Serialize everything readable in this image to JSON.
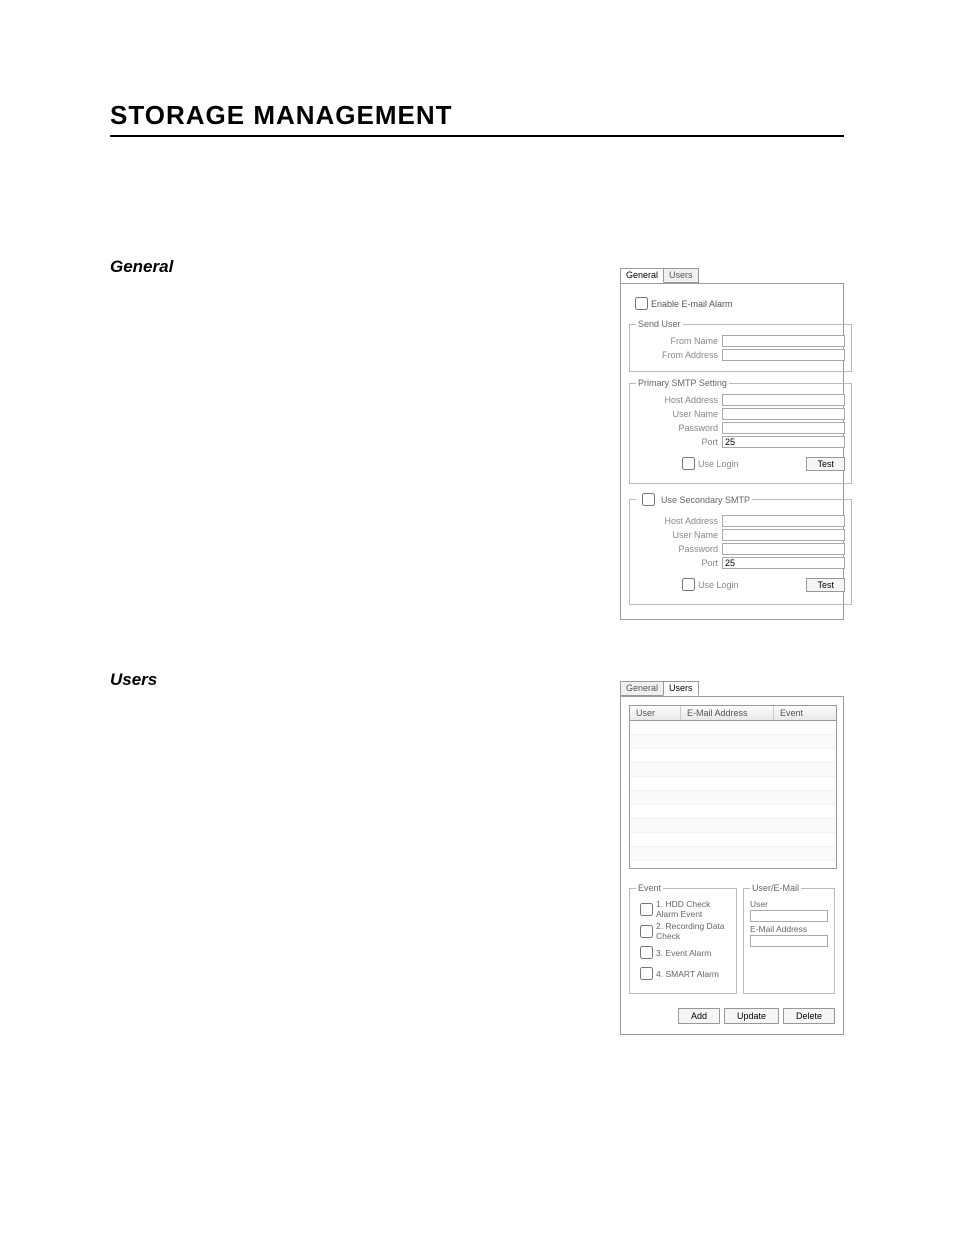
{
  "page": {
    "title": "STORAGE MANAGEMENT"
  },
  "sections": {
    "general": "General",
    "users": "Users"
  },
  "general_panel": {
    "tabs": {
      "general": "General",
      "users": "Users"
    },
    "enable_label": "Enable E-mail Alarm",
    "send_user": {
      "legend": "Send User",
      "from_name": "From Name",
      "from_address": "From Address",
      "from_name_value": "",
      "from_address_value": ""
    },
    "primary": {
      "legend": "Primary SMTP Setting",
      "host_address": "Host Address",
      "user_name": "User Name",
      "password": "Password",
      "port": "Port",
      "host_value": "",
      "user_value": "",
      "pass_value": "",
      "port_value": "25",
      "use_login": "Use Login",
      "test": "Test"
    },
    "secondary": {
      "legend": "Use Secondary SMTP",
      "host_address": "Host Address",
      "user_name": "User Name",
      "password": "Password",
      "port": "Port",
      "host_value": "",
      "user_value": "",
      "pass_value": "",
      "port_value": "25",
      "use_login": "Use Login",
      "test": "Test"
    }
  },
  "users_panel": {
    "tabs": {
      "general": "General",
      "users": "Users"
    },
    "columns": {
      "user": "User",
      "mail": "E-Mail Address",
      "event": "Event"
    },
    "event": {
      "legend": "Event",
      "opts": [
        "1.  HDD Check Alarm Event",
        "2.  Recording Data Check",
        "3.  Event Alarm",
        "4.  SMART Alarm"
      ]
    },
    "user_email": {
      "legend": "User/E-Mail",
      "user": "User",
      "mail": "E-Mail Address",
      "user_value": "",
      "mail_value": ""
    },
    "buttons": {
      "add": "Add",
      "update": "Update",
      "delete": "Delete"
    }
  }
}
